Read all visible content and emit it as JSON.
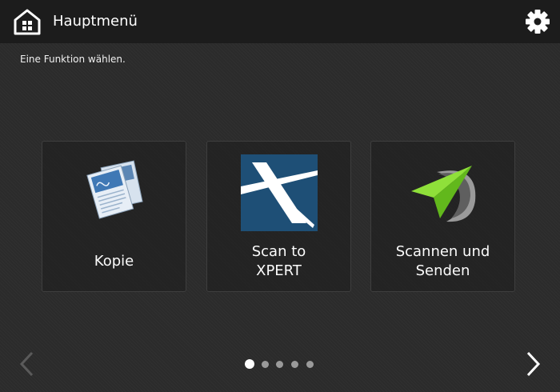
{
  "header": {
    "title": "Hauptmenü",
    "home_icon": "home-icon",
    "settings_icon": "gear-icon"
  },
  "prompt": "Eine Funktion wählen.",
  "tiles": [
    {
      "label": "Kopie",
      "icon": "copy-documents-icon"
    },
    {
      "label": "Scan to\nXPERT",
      "icon": "xpert-logo-icon"
    },
    {
      "label": "Scannen und\nSenden",
      "icon": "paper-plane-icon"
    }
  ],
  "pagination": {
    "total": 5,
    "current": 1
  },
  "colors": {
    "header_bg": "#1c1c1c",
    "xpert_blue": "#1e4f76",
    "plane_green": "#7bd322"
  }
}
